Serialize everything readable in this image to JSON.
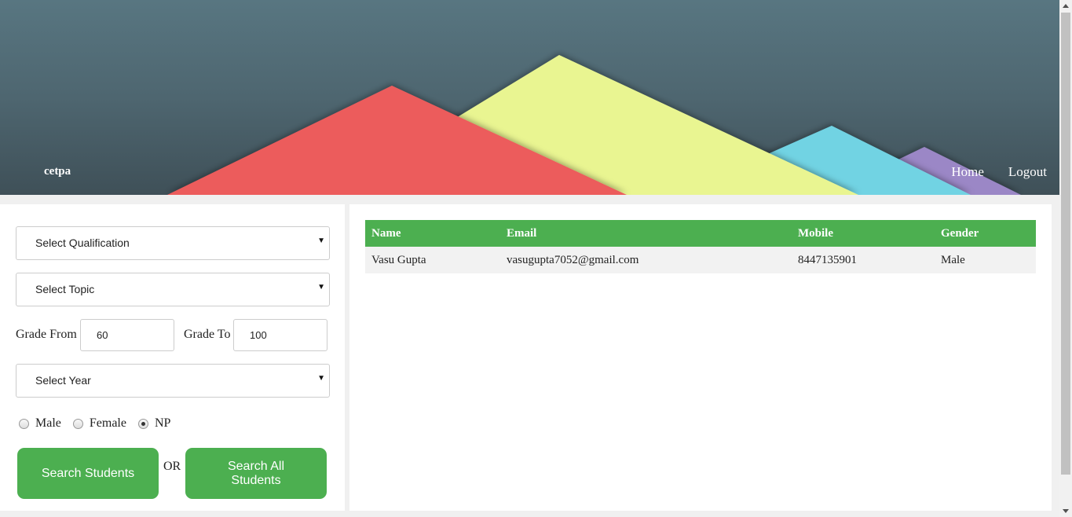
{
  "header": {
    "brand": "cetpa",
    "nav": [
      {
        "label": "Home"
      },
      {
        "label": "Logout"
      }
    ]
  },
  "filters": {
    "qualification": "Select Qualification",
    "topic": "Select Topic",
    "grade_from_label": "Grade From",
    "grade_from_value": "60",
    "grade_to_label": "Grade To",
    "grade_to_value": "100",
    "year": "Select Year",
    "gender_options": [
      {
        "label": "Male",
        "checked": false
      },
      {
        "label": "Female",
        "checked": false
      },
      {
        "label": "NP",
        "checked": true
      }
    ],
    "search_button": "Search Students",
    "or_text": "OR",
    "search_all_button": "Search All Students"
  },
  "results": {
    "columns": [
      "Name",
      "Email",
      "Mobile",
      "Gender"
    ],
    "rows": [
      [
        "Vasu Gupta",
        "vasugupta7052@gmail.com",
        "8447135901",
        "Male"
      ]
    ]
  },
  "colors": {
    "accent": "#4caf50",
    "mountain_red": "#ec5b5b",
    "mountain_yellow": "#e9f591",
    "mountain_cyan": "#71d3e3",
    "mountain_purple": "#9b87c6"
  }
}
